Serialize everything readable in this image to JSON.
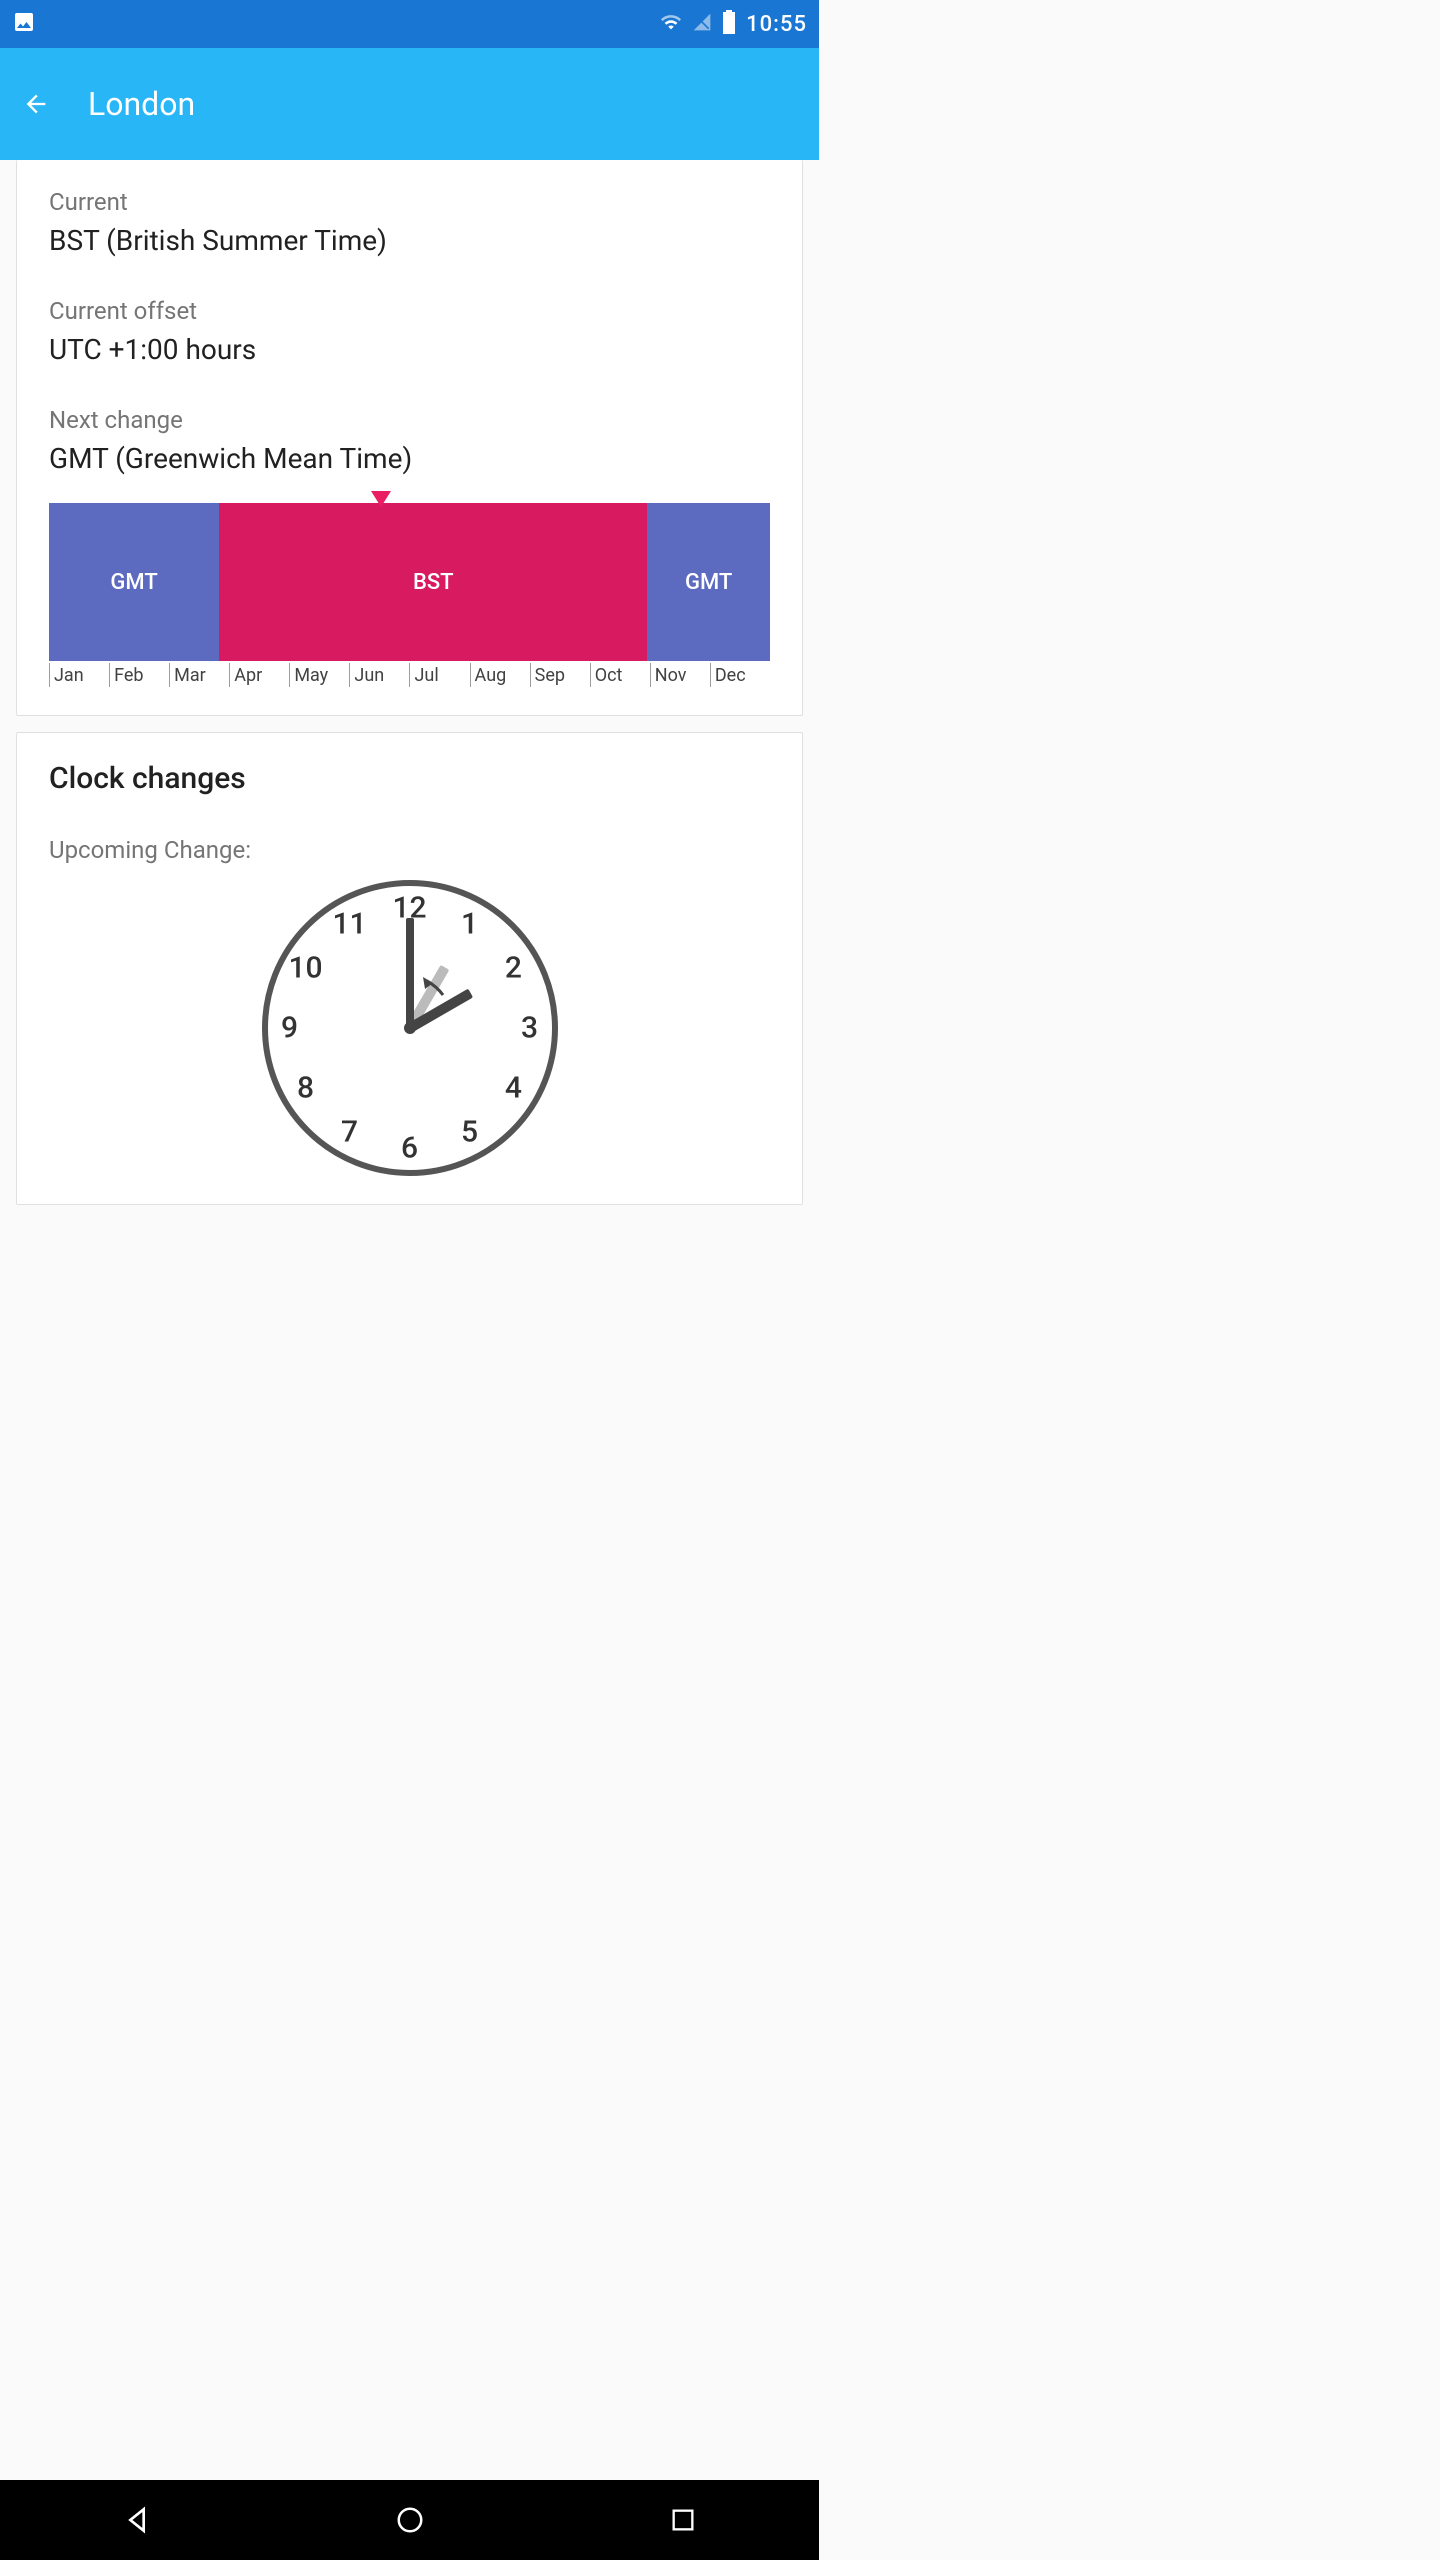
{
  "statusbar": {
    "time": "10:55"
  },
  "appbar": {
    "title": "London"
  },
  "timezone": {
    "current_label": "Current",
    "current_value": "BST (British Summer Time)",
    "offset_label": "Current offset",
    "offset_value": "UTC +1:00 hours",
    "next_label": "Next change",
    "next_value": "GMT (Greenwich Mean Time)"
  },
  "chart_data": {
    "type": "bar",
    "months": [
      "Jan",
      "Feb",
      "Mar",
      "Apr",
      "May",
      "Jun",
      "Jul",
      "Aug",
      "Sep",
      "Oct",
      "Nov",
      "Dec"
    ],
    "segments": [
      {
        "label": "GMT",
        "from": "Jan",
        "to": "Mar",
        "width_pct": 23.6,
        "color": "#5C6BC0"
      },
      {
        "label": "BST",
        "from": "Apr",
        "to": "Oct",
        "width_pct": 59.4,
        "color": "#D81B60"
      },
      {
        "label": "GMT",
        "from": "Nov",
        "to": "Dec",
        "width_pct": 17.0,
        "color": "#5C6BC0"
      }
    ],
    "current_marker_pct": 46.0
  },
  "clock_changes": {
    "title": "Clock changes",
    "upcoming_label": "Upcoming Change:",
    "clock_numbers": [
      "12",
      "1",
      "2",
      "3",
      "4",
      "5",
      "6",
      "7",
      "8",
      "9",
      "10",
      "11"
    ]
  }
}
